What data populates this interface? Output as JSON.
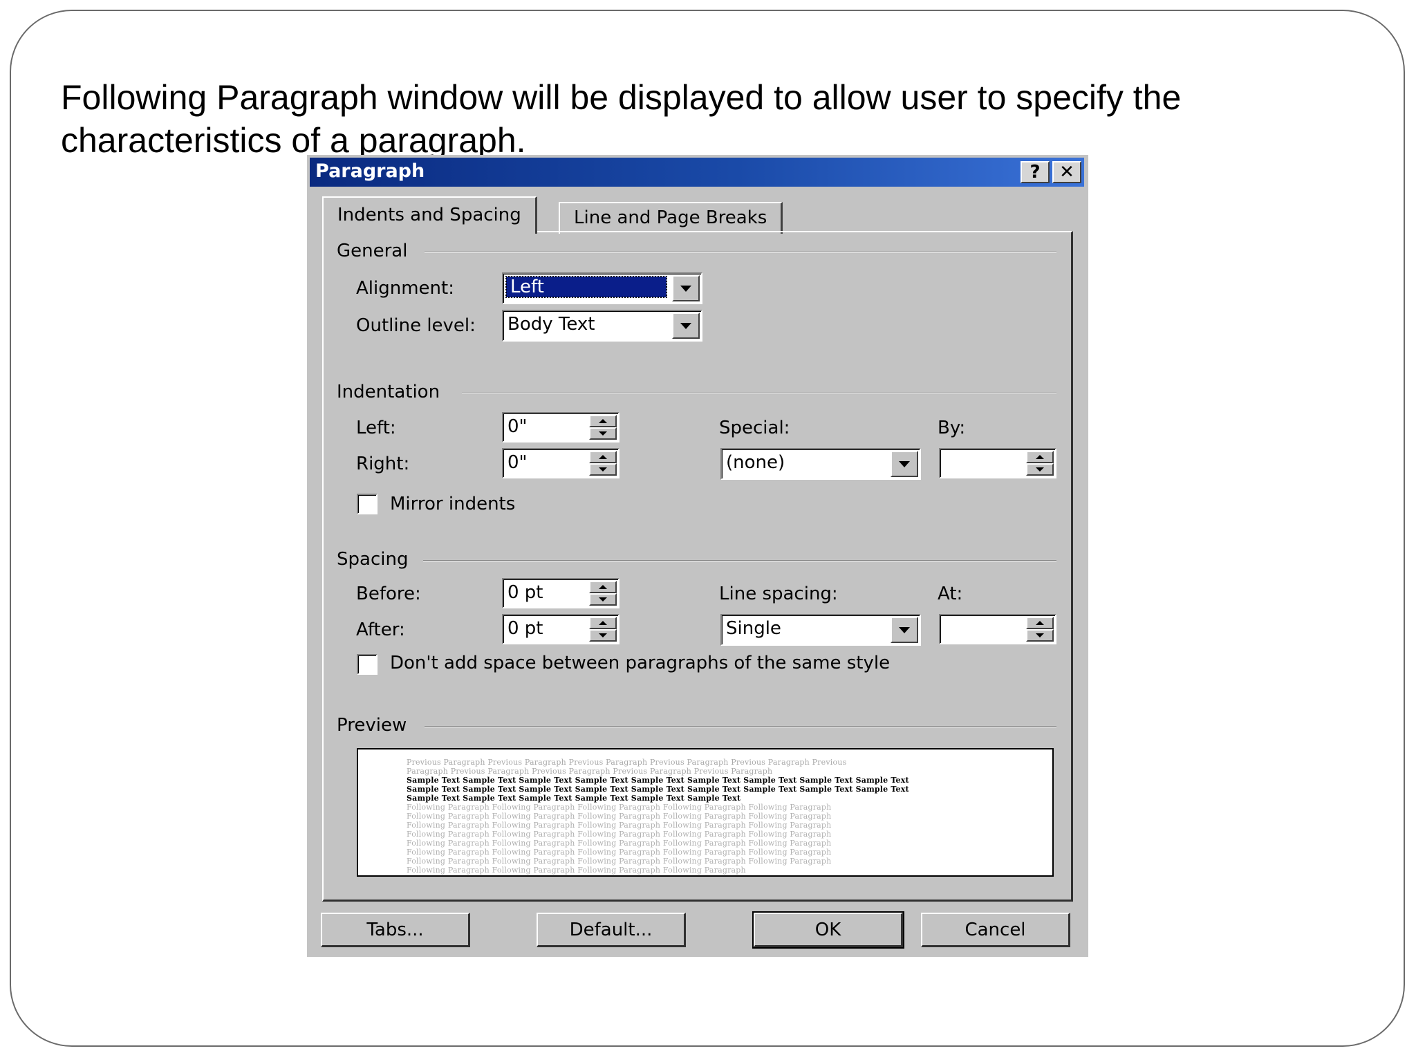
{
  "caption": "Following Paragraph window will be displayed to allow user to specify the characteristics of a paragraph.",
  "dialog": {
    "title": "Paragraph",
    "help_glyph": "?",
    "close_glyph": "✕",
    "tabs": [
      {
        "label": "Indents and Spacing",
        "active": true
      },
      {
        "label": "Line and Page Breaks",
        "active": false
      }
    ],
    "general": {
      "heading": "General",
      "alignment_label": "Alignment:",
      "alignment_value": "Left",
      "outline_label": "Outline level:",
      "outline_value": "Body Text"
    },
    "indentation": {
      "heading": "Indentation",
      "left_label": "Left:",
      "left_value": "0\"",
      "right_label": "Right:",
      "right_value": "0\"",
      "special_label": "Special:",
      "special_value": "(none)",
      "by_label": "By:",
      "by_value": "",
      "mirror_label": "Mirror indents",
      "mirror_checked": false
    },
    "spacing": {
      "heading": "Spacing",
      "before_label": "Before:",
      "before_value": "0 pt",
      "after_label": "After:",
      "after_value": "0 pt",
      "line_spacing_label": "Line spacing:",
      "line_spacing_value": "Single",
      "at_label": "At:",
      "at_value": "",
      "dont_add_label": "Don't add space between paragraphs of the same style",
      "dont_add_checked": false
    },
    "preview": {
      "heading": "Preview",
      "lines": [
        {
          "kind": "prev",
          "text": "Previous Paragraph Previous Paragraph Previous Paragraph Previous Paragraph Previous Paragraph Previous"
        },
        {
          "kind": "prev",
          "text": "Paragraph Previous Paragraph Previous Paragraph Previous Paragraph Previous Paragraph"
        },
        {
          "kind": "sample",
          "text": "Sample Text Sample Text Sample Text Sample Text Sample Text Sample Text Sample Text Sample Text Sample Text"
        },
        {
          "kind": "sample",
          "text": "Sample Text Sample Text Sample Text Sample Text Sample Text Sample Text Sample Text Sample Text Sample Text"
        },
        {
          "kind": "sample",
          "text": "Sample Text Sample Text Sample Text Sample Text Sample Text Sample Text"
        },
        {
          "kind": "next",
          "text": "Following Paragraph Following Paragraph Following Paragraph Following Paragraph Following Paragraph"
        },
        {
          "kind": "next",
          "text": "Following Paragraph Following Paragraph Following Paragraph Following Paragraph Following Paragraph"
        },
        {
          "kind": "next",
          "text": "Following Paragraph Following Paragraph Following Paragraph Following Paragraph Following Paragraph"
        },
        {
          "kind": "next",
          "text": "Following Paragraph Following Paragraph Following Paragraph Following Paragraph Following Paragraph"
        },
        {
          "kind": "next",
          "text": "Following Paragraph Following Paragraph Following Paragraph Following Paragraph Following Paragraph"
        },
        {
          "kind": "next",
          "text": "Following Paragraph Following Paragraph Following Paragraph Following Paragraph Following Paragraph"
        },
        {
          "kind": "next",
          "text": "Following Paragraph Following Paragraph Following Paragraph Following Paragraph Following Paragraph"
        },
        {
          "kind": "next",
          "text": "Following Paragraph Following Paragraph Following Paragraph Following Paragraph"
        }
      ]
    },
    "buttons": {
      "tabs": "Tabs...",
      "default": "Default...",
      "ok": "OK",
      "cancel": "Cancel"
    }
  },
  "colors": {
    "dialog_face": "#c3c3c3",
    "title_start": "#0a2a80",
    "title_end": "#3a72d8",
    "selection": "#0a1e8a"
  }
}
